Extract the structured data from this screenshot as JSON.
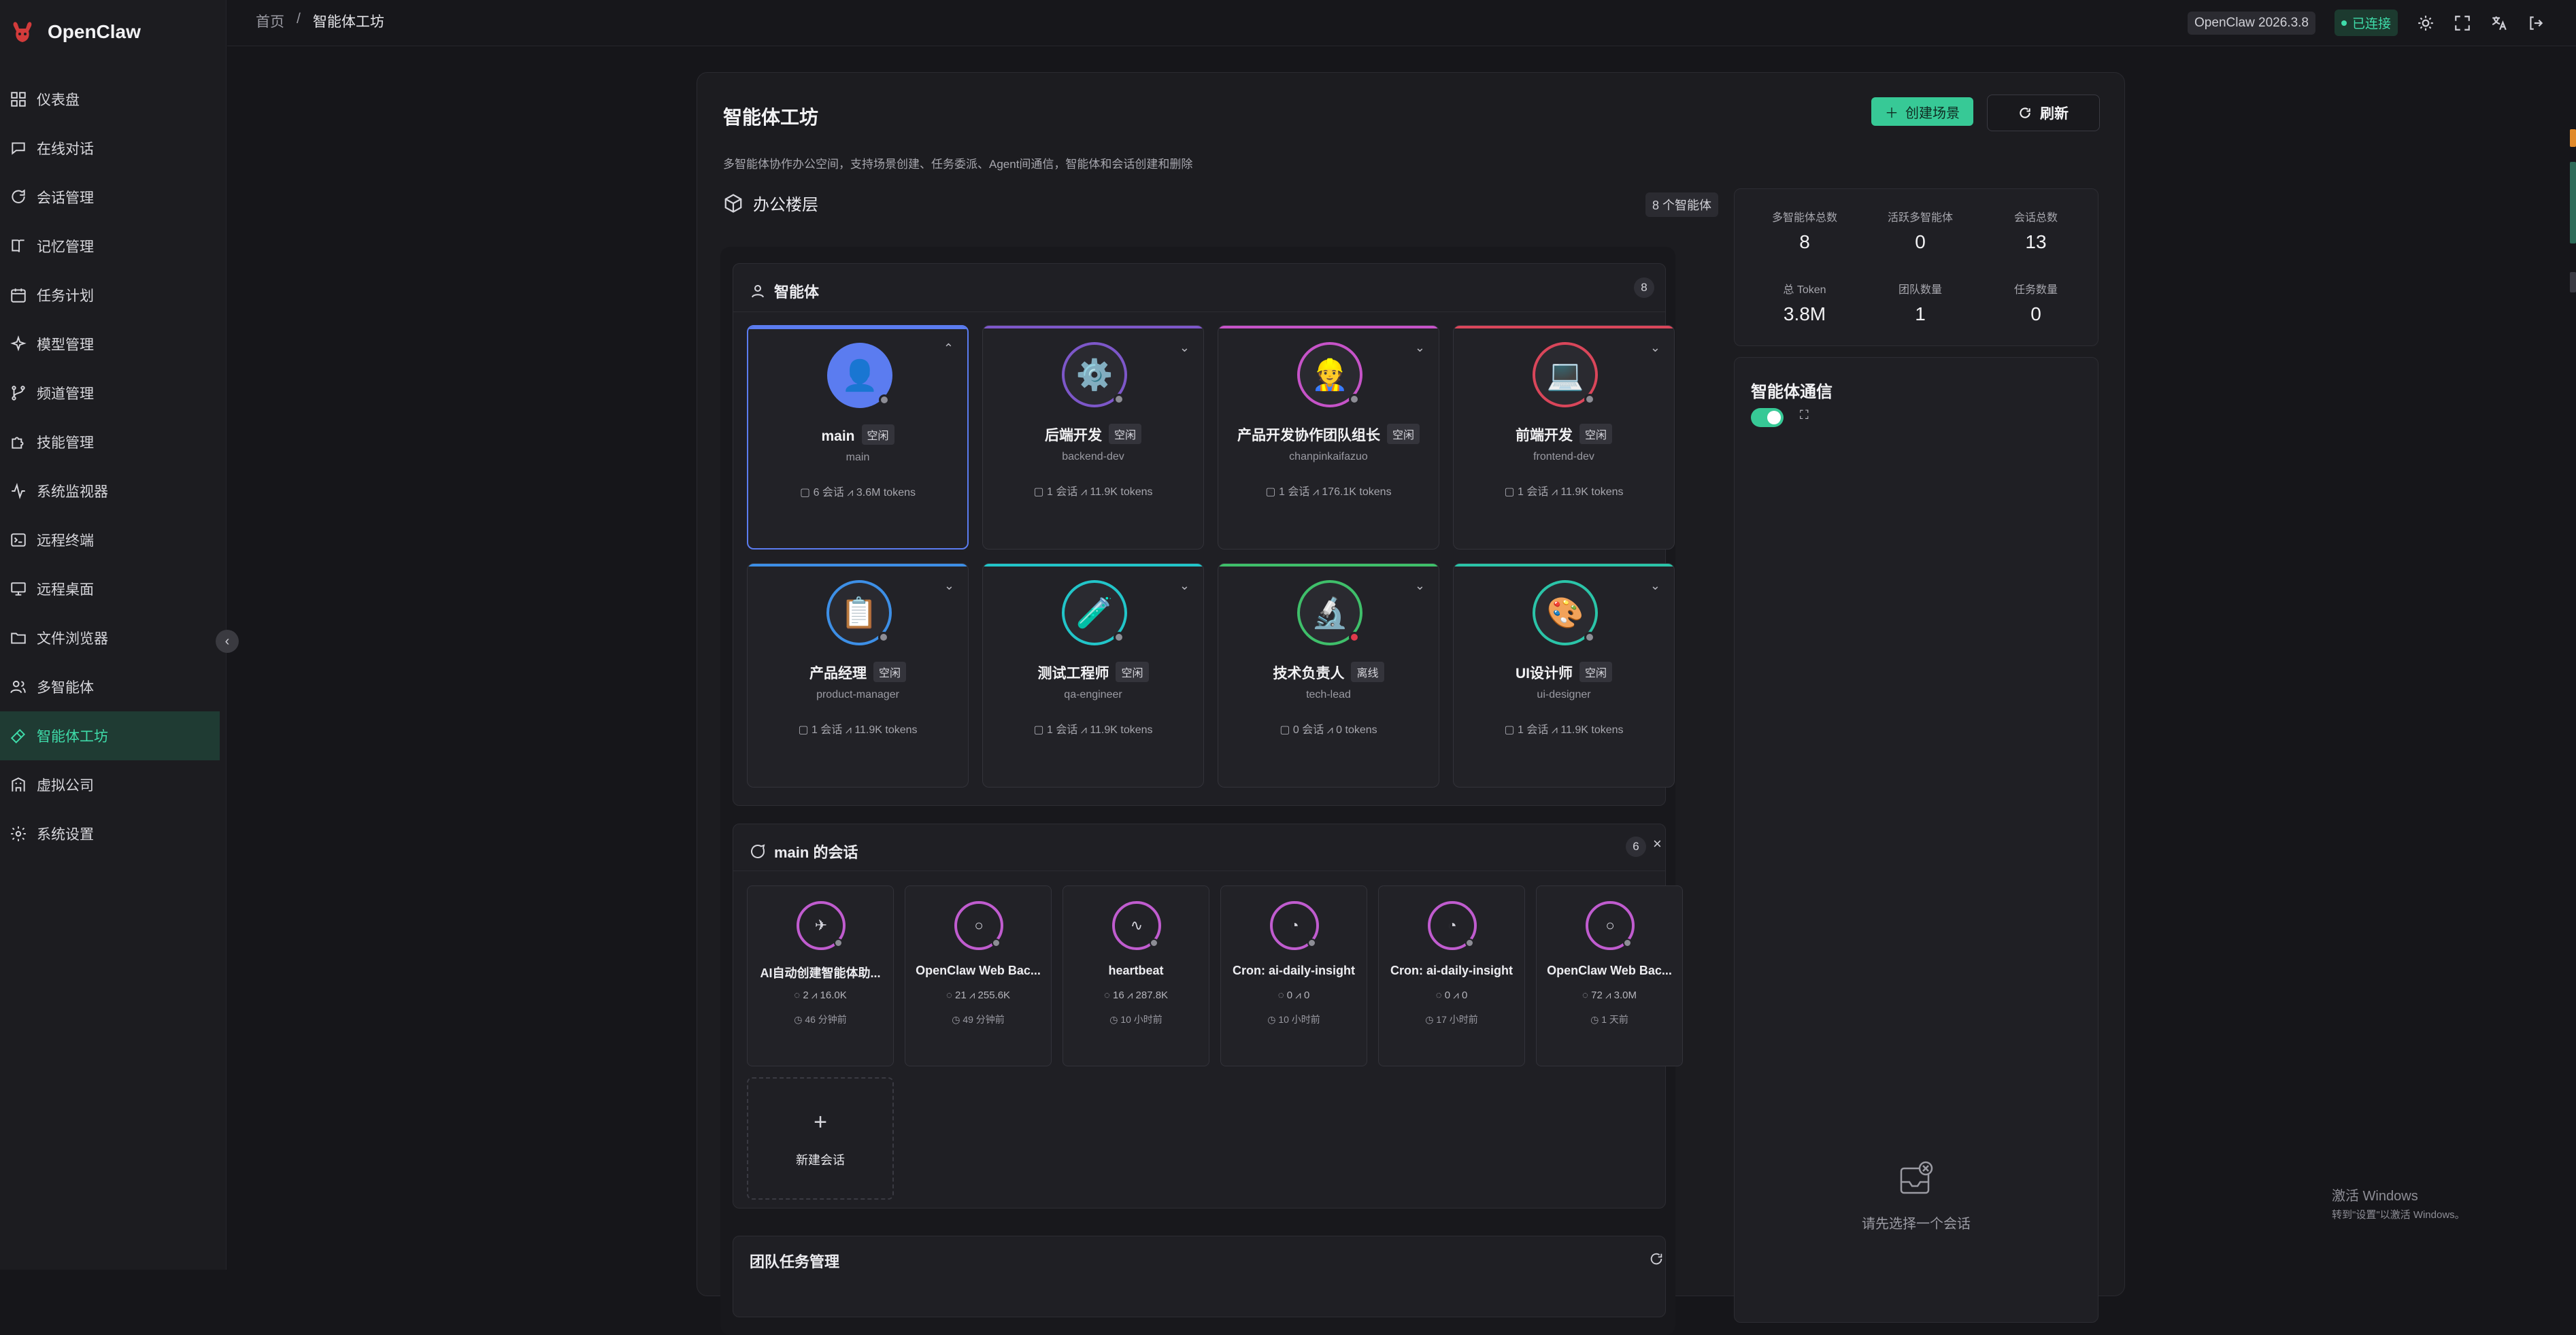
{
  "app": {
    "name": "OpenClaw"
  },
  "sidebar": {
    "items": [
      {
        "label": "仪表盘",
        "icon": "dashboard-icon"
      },
      {
        "label": "在线对话",
        "icon": "chat-icon"
      },
      {
        "label": "会话管理",
        "icon": "sessions-icon"
      },
      {
        "label": "记忆管理",
        "icon": "book-icon"
      },
      {
        "label": "任务计划",
        "icon": "calendar-icon"
      },
      {
        "label": "模型管理",
        "icon": "sparkle-icon"
      },
      {
        "label": "频道管理",
        "icon": "branch-icon"
      },
      {
        "label": "技能管理",
        "icon": "puzzle-icon"
      },
      {
        "label": "系统监视器",
        "icon": "activity-icon"
      },
      {
        "label": "远程终端",
        "icon": "terminal-icon"
      },
      {
        "label": "远程桌面",
        "icon": "monitor-icon"
      },
      {
        "label": "文件浏览器",
        "icon": "folder-icon"
      },
      {
        "label": "多智能体",
        "icon": "users-icon"
      },
      {
        "label": "智能体工坊",
        "icon": "workshop-icon",
        "active": true
      },
      {
        "label": "虚拟公司",
        "icon": "building-icon"
      },
      {
        "label": "系统设置",
        "icon": "settings-icon"
      }
    ]
  },
  "topbar": {
    "breadcrumb": {
      "home": "首页",
      "sep": "/",
      "current": "智能体工坊"
    },
    "version": "OpenClaw 2026.3.8",
    "status": "已连接"
  },
  "page": {
    "title": "智能体工坊",
    "subtitle": "多智能体协作办公空间，支持场景创建、任务委派、Agent间通信，智能体和会话创建和删除",
    "create_button": "创建场景",
    "refresh_button": "刷新",
    "office": {
      "title": "办公楼层",
      "agent_count": "8 个智能体"
    }
  },
  "agents_panel": {
    "title": "智能体",
    "count": "8",
    "agents": [
      {
        "name": "main",
        "status": "空闲",
        "id": "main",
        "sessions": "6 会话",
        "tokens": "3.6M tokens",
        "accent": "#5b7cf0",
        "emoji": "👤",
        "online": "idle"
      },
      {
        "name": "后端开发",
        "status": "空闲",
        "id": "backend-dev",
        "sessions": "1 会话",
        "tokens": "11.9K tokens",
        "accent": "#7d57c9",
        "emoji": "⚙️",
        "online": "idle"
      },
      {
        "name": "产品开发协作团队组长",
        "status": "空闲",
        "id": "chanpinkaifazuo",
        "sessions": "1 会话",
        "tokens": "176.1K tokens",
        "accent": "#c653c8",
        "emoji": "👷",
        "online": "idle"
      },
      {
        "name": "前端开发",
        "status": "空闲",
        "id": "frontend-dev",
        "sessions": "1 会话",
        "tokens": "11.9K tokens",
        "accent": "#d9465a",
        "emoji": "💻",
        "online": "idle"
      },
      {
        "name": "产品经理",
        "status": "空闲",
        "id": "product-manager",
        "sessions": "1 会话",
        "tokens": "11.9K tokens",
        "accent": "#3d8fe6",
        "emoji": "📋",
        "online": "idle"
      },
      {
        "name": "测试工程师",
        "status": "空闲",
        "id": "qa-engineer",
        "sessions": "1 会话",
        "tokens": "11.9K tokens",
        "accent": "#22c5c9",
        "emoji": "🧪",
        "online": "idle"
      },
      {
        "name": "技术负责人",
        "status": "离线",
        "id": "tech-lead",
        "sessions": "0 会话",
        "tokens": "0 tokens",
        "accent": "#3fbf6a",
        "emoji": "🔬",
        "online": "offline"
      },
      {
        "name": "UI设计师",
        "status": "空闲",
        "id": "ui-designer",
        "sessions": "1 会话",
        "tokens": "11.9K tokens",
        "accent": "#2bc4a8",
        "emoji": "🎨",
        "online": "idle"
      }
    ]
  },
  "sessions_panel": {
    "title": "main 的会话",
    "count": "6",
    "close": "×",
    "sessions": [
      {
        "title": "AI自动创建智能体助...",
        "messages": "2",
        "tokens": "16.0K",
        "time": "46 分钟前",
        "glyph": "✈"
      },
      {
        "title": "OpenClaw Web Bac...",
        "messages": "21",
        "tokens": "255.6K",
        "time": "49 分钟前",
        "glyph": "○"
      },
      {
        "title": "heartbeat",
        "messages": "16",
        "tokens": "287.8K",
        "time": "10 小时前",
        "glyph": "∿"
      },
      {
        "title": "Cron: ai-daily-insight",
        "messages": "0",
        "tokens": "0",
        "time": "10 小时前",
        "glyph": "◔"
      },
      {
        "title": "Cron: ai-daily-insight",
        "messages": "0",
        "tokens": "0",
        "time": "17 小时前",
        "glyph": "◔"
      },
      {
        "title": "OpenClaw Web Bac...",
        "messages": "72",
        "tokens": "3.0M",
        "time": "1 天前",
        "glyph": "○"
      }
    ],
    "new_session": "新建会话"
  },
  "team_panel": {
    "title": "团队任务管理"
  },
  "stats": [
    {
      "label": "多智能体总数",
      "value": "8"
    },
    {
      "label": "活跃多智能体",
      "value": "0"
    },
    {
      "label": "会话总数",
      "value": "13"
    },
    {
      "label": "总 Token",
      "value": "3.8M"
    },
    {
      "label": "团队数量",
      "value": "1"
    },
    {
      "label": "任务数量",
      "value": "0"
    }
  ],
  "comm": {
    "title": "智能体通信",
    "empty": "请先选择一个会话"
  },
  "watermark": {
    "line1": "激活 Windows",
    "line2": "转到\"设置\"以激活 Windows。"
  }
}
